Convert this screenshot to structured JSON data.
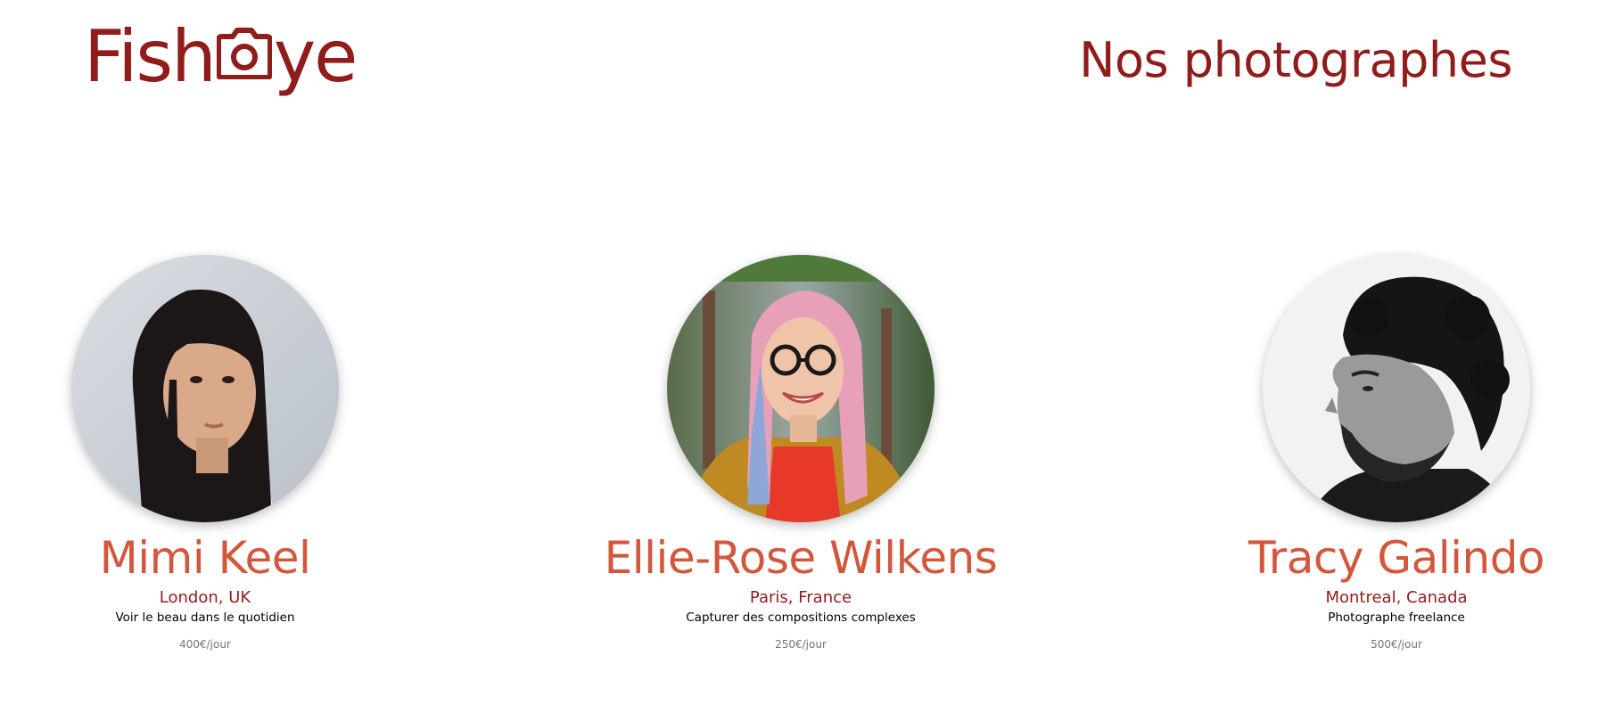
{
  "header": {
    "logo": {
      "left": "Fish",
      "right": "ye",
      "icon": "camera-icon"
    },
    "title": "Nos photographes"
  },
  "colors": {
    "brand": "#901C1C",
    "accent": "#D3573C",
    "muted": "#757575"
  },
  "photographers": [
    {
      "name": "Mimi Keel",
      "location": "London, UK",
      "tagline": "Voir le beau dans le quotidien",
      "price": "400€/jour"
    },
    {
      "name": "Ellie-Rose Wilkens",
      "location": "Paris, France",
      "tagline": "Capturer des compositions complexes",
      "price": "250€/jour"
    },
    {
      "name": "Tracy Galindo",
      "location": "Montreal, Canada",
      "tagline": "Photographe freelance",
      "price": "500€/jour"
    }
  ]
}
